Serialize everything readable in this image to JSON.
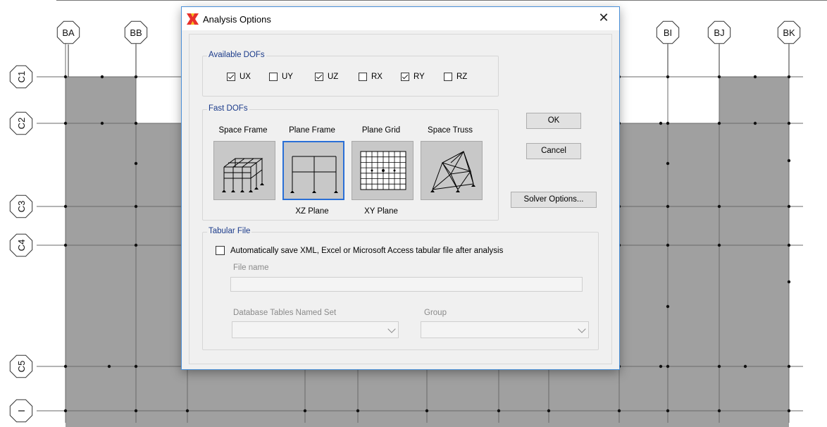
{
  "background": {
    "top_column_tags": [
      "BA",
      "BB",
      "BI",
      "BJ",
      "BK"
    ],
    "left_row_tags": [
      "C1",
      "C2",
      "C3",
      "C4",
      "C5",
      "I"
    ]
  },
  "dialog": {
    "title": "Analysis Options",
    "close_glyph": "✕",
    "available_dofs": {
      "label": "Available DOFs",
      "items": [
        {
          "label": "UX",
          "checked": true
        },
        {
          "label": "UY",
          "checked": false
        },
        {
          "label": "UZ",
          "checked": true
        },
        {
          "label": "RX",
          "checked": false
        },
        {
          "label": "RY",
          "checked": true
        },
        {
          "label": "RZ",
          "checked": false
        }
      ]
    },
    "fast_dofs": {
      "label": "Fast DOFs",
      "options": [
        {
          "label": "Space Frame",
          "sub": "",
          "icon": "space-frame-icon"
        },
        {
          "label": "Plane Frame",
          "sub": "XZ Plane",
          "icon": "plane-frame-icon",
          "selected": true
        },
        {
          "label": "Plane Grid",
          "sub": "XY Plane",
          "icon": "plane-grid-icon"
        },
        {
          "label": "Space Truss",
          "sub": "",
          "icon": "space-truss-icon"
        }
      ]
    },
    "buttons": {
      "ok": "OK",
      "cancel": "Cancel",
      "solver": "Solver Options..."
    },
    "tabular_file": {
      "label": "Tabular File",
      "checkbox_label": "Automatically save XML, Excel or Microsoft Access tabular file after analysis",
      "checked": false,
      "file_name_label": "File name",
      "file_name_value": "",
      "named_set_label": "Database Tables Named Set",
      "named_set_value": "",
      "group_label": "Group",
      "group_value": ""
    }
  },
  "colors": {
    "panel_fill": "#a0a0a0",
    "accent": "#2a6fd6",
    "group_label": "#1a3a8a"
  }
}
